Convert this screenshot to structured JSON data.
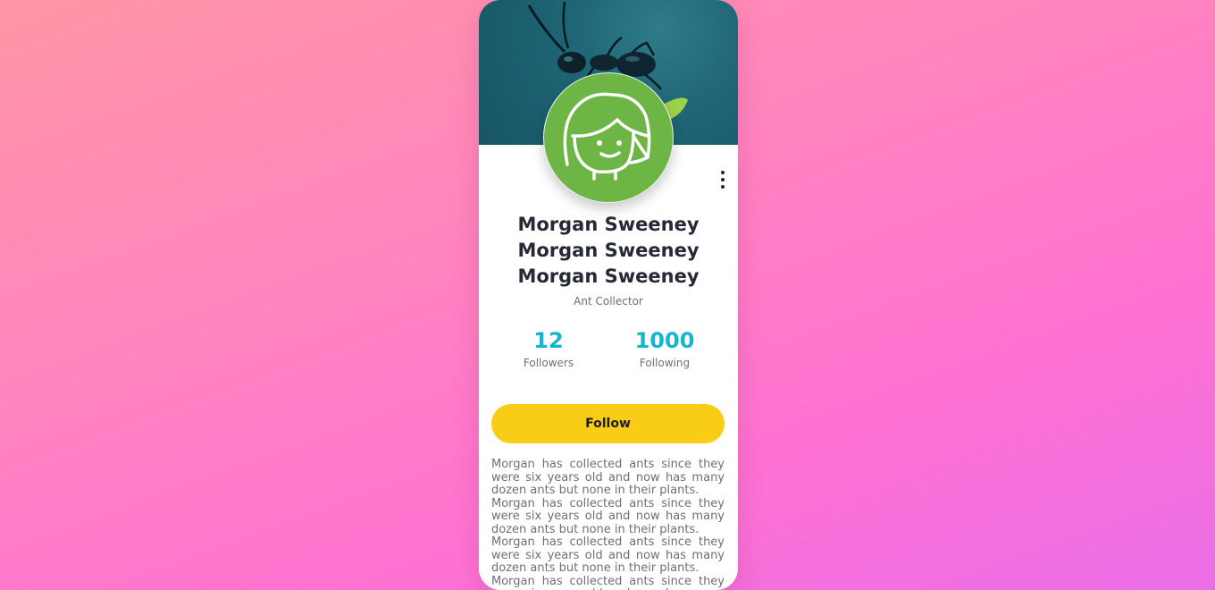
{
  "profile": {
    "names": [
      "Morgan Sweeney",
      "Morgan Sweeney",
      "Morgan Sweeney"
    ],
    "role": "Ant Collector",
    "cover_image": "ant-on-leaf-photo",
    "avatar_image": "girl-face-drawing"
  },
  "stats": [
    {
      "value": "12",
      "label": "Followers"
    },
    {
      "value": "1000",
      "label": "Following"
    }
  ],
  "actions": {
    "follow_label": "Follow",
    "menu_icon": "more-vertical-icon"
  },
  "bio": [
    "Morgan has collected ants since they were six years old and now has many dozen ants but none in their plants.",
    "Morgan has collected ants since they were six years old and now has many dozen ants but none in their plants.",
    "Morgan has collected ants since they were six years old and now has many dozen ants but none in their plants.",
    "Morgan has collected ants since they were six years old and now has many dozen ants but none in their plants."
  ],
  "colors": {
    "accent": "#16b4cf",
    "button": "#f9cc15",
    "avatar_bg": "#6db544",
    "name_text": "#262a36"
  }
}
